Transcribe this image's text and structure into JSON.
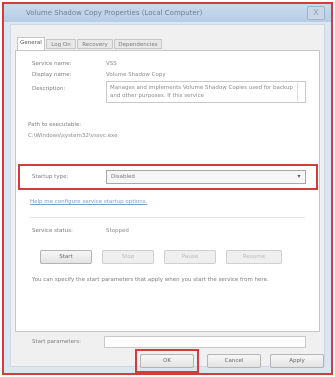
{
  "window": {
    "title": "Volume Shadow Copy Properties (Local Computer)",
    "close_glyph": "X"
  },
  "tabs": [
    {
      "label": "General",
      "active": true
    },
    {
      "label": "Log On",
      "active": false
    },
    {
      "label": "Recovery",
      "active": false
    },
    {
      "label": "Dependencies",
      "active": false
    }
  ],
  "general": {
    "service_name_label": "Service name:",
    "service_name": "VSS",
    "display_name_label": "Display name:",
    "display_name": "Volume Shadow Copy",
    "description_label": "Description:",
    "description": "Manages and implements Volume Shadow Copies used for backup and other purposes. If this service",
    "path_label": "Path to executable:",
    "path": "C:\\Windows\\system32\\vssvc.exe",
    "startup_type_label": "Startup type:",
    "startup_type": "Disabled",
    "help_link": "Help me configure service startup options.",
    "service_status_label": "Service status:",
    "service_status": "Stopped",
    "start_button": "Start",
    "stop_button": "Stop",
    "pause_button": "Pause",
    "resume_button": "Resume",
    "start_params_note": "You can specify the start parameters that apply when you start the service from here.",
    "start_params_label": "Start parameters:",
    "start_params_value": ""
  },
  "footer": {
    "ok": "OK",
    "cancel": "Cancel",
    "apply": "Apply"
  },
  "colors": {
    "highlight": "#d63b3b",
    "link": "#7a9cc6"
  },
  "icons": {
    "dropdown": "chevron-down-icon",
    "close": "close-icon"
  }
}
